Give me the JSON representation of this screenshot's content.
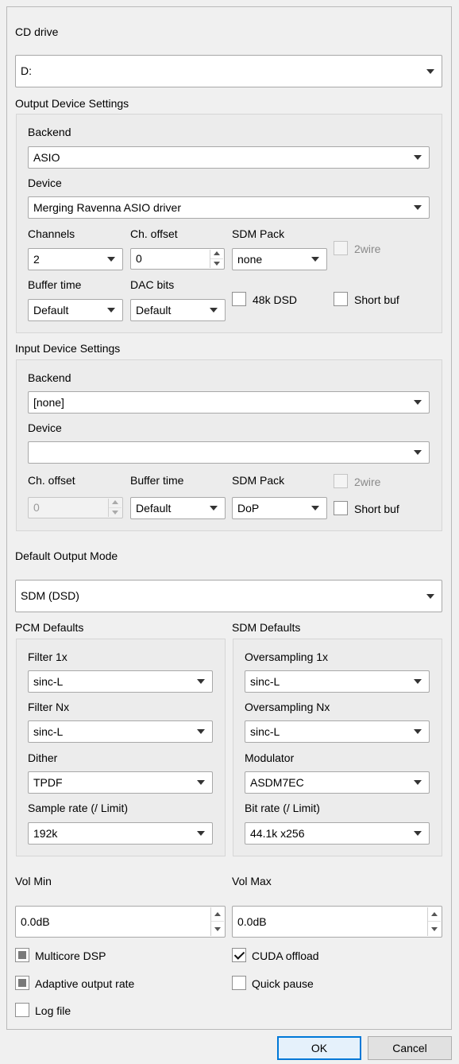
{
  "cd_drive": {
    "label": "CD drive",
    "value": "D:"
  },
  "output": {
    "title": "Output Device Settings",
    "backend_label": "Backend",
    "backend_value": "ASIO",
    "device_label": "Device",
    "device_value": "Merging Ravenna ASIO driver",
    "channels_label": "Channels",
    "channels_value": "2",
    "ch_offset_label": "Ch. offset",
    "ch_offset_value": "0",
    "sdm_pack_label": "SDM Pack",
    "sdm_pack_value": "none",
    "twowire_label": "2wire",
    "buffer_time_label": "Buffer time",
    "buffer_time_value": "Default",
    "dac_bits_label": "DAC bits",
    "dac_bits_value": "Default",
    "dsd48k_label": "48k DSD",
    "short_buf_label": "Short buf"
  },
  "input": {
    "title": "Input Device Settings",
    "backend_label": "Backend",
    "backend_value": "[none]",
    "device_label": "Device",
    "device_value": "",
    "ch_offset_label": "Ch. offset",
    "ch_offset_value": "0",
    "buffer_time_label": "Buffer time",
    "buffer_time_value": "Default",
    "sdm_pack_label": "SDM Pack",
    "sdm_pack_value": "DoP",
    "twowire_label": "2wire",
    "short_buf_label": "Short buf"
  },
  "default_output_mode": {
    "label": "Default Output Mode",
    "value": "SDM (DSD)"
  },
  "pcm_defaults": {
    "title": "PCM Defaults",
    "filter1x_label": "Filter 1x",
    "filter1x_value": "sinc-L",
    "filternx_label": "Filter Nx",
    "filternx_value": "sinc-L",
    "dither_label": "Dither",
    "dither_value": "TPDF",
    "sample_rate_label": "Sample rate (/ Limit)",
    "sample_rate_value": "192k"
  },
  "sdm_defaults": {
    "title": "SDM Defaults",
    "os1x_label": "Oversampling 1x",
    "os1x_value": "sinc-L",
    "osnx_label": "Oversampling Nx",
    "osnx_value": "sinc-L",
    "modulator_label": "Modulator",
    "modulator_value": "ASDM7EC",
    "bit_rate_label": "Bit rate (/ Limit)",
    "bit_rate_value": "44.1k x256"
  },
  "vol_min": {
    "label": "Vol Min",
    "value": "0.0dB"
  },
  "vol_max": {
    "label": "Vol Max",
    "value": "0.0dB"
  },
  "options": {
    "multicore_dsp": "Multicore DSP",
    "cuda_offload": "CUDA offload",
    "adaptive_output_rate": "Adaptive output rate",
    "quick_pause": "Quick pause",
    "log_file": "Log file"
  },
  "buttons": {
    "ok": "OK",
    "cancel": "Cancel"
  }
}
